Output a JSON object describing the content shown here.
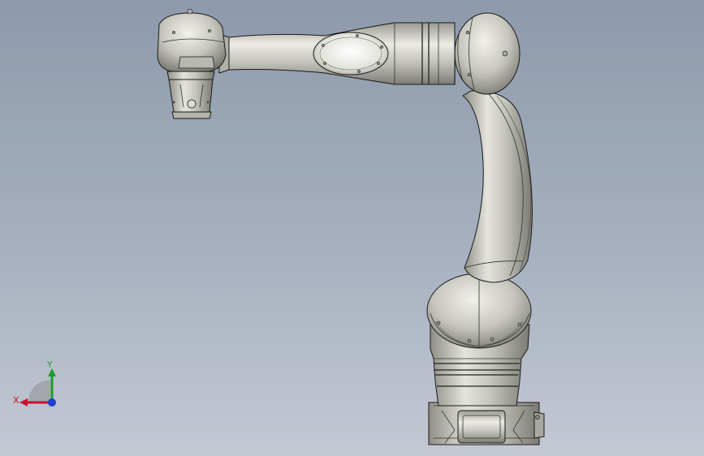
{
  "viewport": {
    "background_top": "#8e9aac",
    "background_bottom": "#c3c9d3",
    "model_fill": "#c4c4bc",
    "model_stroke": "#1a1a1a"
  },
  "model": {
    "parts": [
      "base",
      "shoulder-joint",
      "upper-arm",
      "elbow-joint",
      "forearm",
      "wrist-joint",
      "tool-flange"
    ]
  },
  "triad": {
    "x_label": "X",
    "y_label": "Y",
    "x_color": "#c8102e",
    "y_color": "#1a9c2a",
    "z_color": "#1f3fd0"
  }
}
